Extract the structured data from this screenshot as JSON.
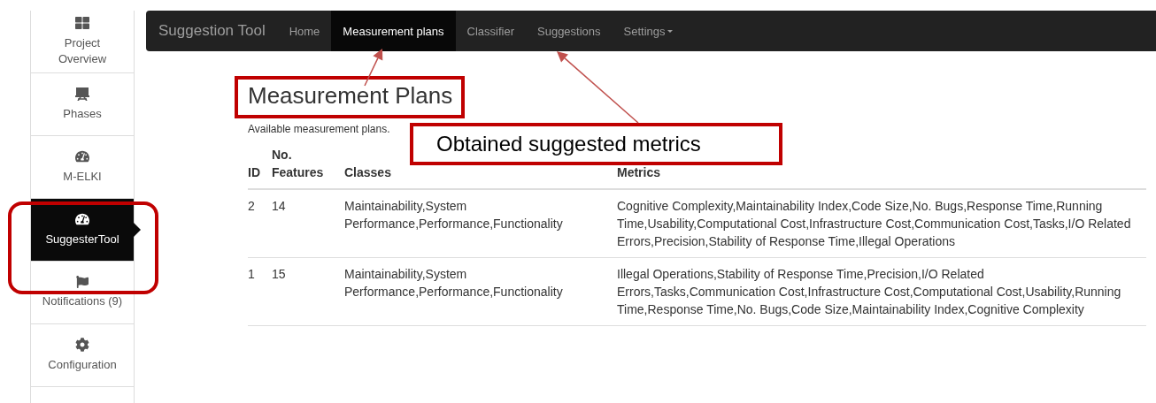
{
  "sidebar": {
    "items": [
      {
        "label": "Project\nOverview",
        "selected": false
      },
      {
        "label": "Phases",
        "selected": false
      },
      {
        "label": "M-ELKI",
        "selected": false
      },
      {
        "label": "SuggesterTool",
        "selected": true
      },
      {
        "label": "Notifications (9)",
        "selected": false
      },
      {
        "label": "Configuration",
        "selected": false
      }
    ]
  },
  "navbar": {
    "brand": "Suggestion Tool",
    "items": [
      {
        "label": "Home",
        "selected": false,
        "kind": "link"
      },
      {
        "label": "Measurement plans",
        "selected": true,
        "kind": "link"
      },
      {
        "label": "Classifier",
        "selected": false,
        "kind": "link"
      },
      {
        "label": "Suggestions",
        "selected": false,
        "kind": "link"
      },
      {
        "label": "Settings",
        "selected": false,
        "kind": "dropdown"
      }
    ]
  },
  "page": {
    "heading": "Measurement Plans",
    "subtitle": "Available measurement plans."
  },
  "table": {
    "columns": [
      "ID",
      "No.\nFeatures",
      "Classes",
      "Metrics"
    ],
    "rows": [
      [
        "2",
        "14",
        "Maintainability,System Performance,Performance,Functionality",
        "Cognitive Complexity,Maintainability Index,Code Size,No. Bugs,Response Time,Running Time,Usability,Computational Cost,Infrastructure Cost,Communication Cost,Tasks,I/O Related Errors,Precision,Stability of Response Time,Illegal Operations"
      ],
      [
        "1",
        "15",
        "Maintainability,System Performance,Performance,Functionality",
        "Illegal Operations,Stability of Response Time,Precision,I/O Related Errors,Tasks,Communication Cost,Infrastructure Cost,Computational Cost,Usability,Running Time,Response Time,No. Bugs,Code Size,Maintainability Index,Cognitive Complexity"
      ]
    ]
  },
  "annotations": {
    "callout": "Obtained suggested metrics"
  }
}
